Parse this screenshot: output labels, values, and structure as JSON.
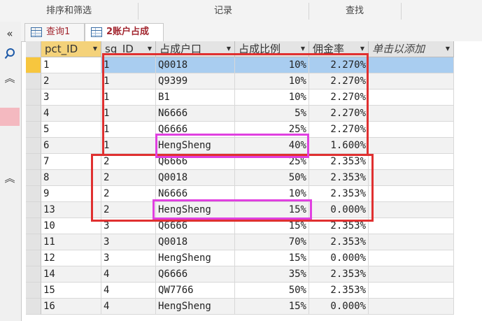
{
  "ribbon": {
    "groups": [
      "排序和筛选",
      "记录",
      "查找"
    ]
  },
  "tabs": [
    {
      "label": "查询1",
      "active": false
    },
    {
      "label": "2账户占成",
      "active": true
    }
  ],
  "columns": [
    "pct_ID",
    "sg_ID",
    "占成户口",
    "占成比例",
    "佣金率",
    "单击以添加"
  ],
  "rows": [
    {
      "pct_ID": "1",
      "sg_ID": "1",
      "account": "Q0018",
      "ratio": "10%",
      "rate": "2.270%"
    },
    {
      "pct_ID": "2",
      "sg_ID": "1",
      "account": "Q9399",
      "ratio": "10%",
      "rate": "2.270%"
    },
    {
      "pct_ID": "3",
      "sg_ID": "1",
      "account": "B1",
      "ratio": "10%",
      "rate": "2.270%"
    },
    {
      "pct_ID": "4",
      "sg_ID": "1",
      "account": "N6666",
      "ratio": "5%",
      "rate": "2.270%"
    },
    {
      "pct_ID": "5",
      "sg_ID": "1",
      "account": "Q6666",
      "ratio": "25%",
      "rate": "2.270%"
    },
    {
      "pct_ID": "6",
      "sg_ID": "1",
      "account": "HengSheng",
      "ratio": "40%",
      "rate": "1.600%"
    },
    {
      "pct_ID": "7",
      "sg_ID": "2",
      "account": "Q6666",
      "ratio": "25%",
      "rate": "2.353%"
    },
    {
      "pct_ID": "8",
      "sg_ID": "2",
      "account": "Q0018",
      "ratio": "50%",
      "rate": "2.353%"
    },
    {
      "pct_ID": "9",
      "sg_ID": "2",
      "account": "N6666",
      "ratio": "10%",
      "rate": "2.353%"
    },
    {
      "pct_ID": "13",
      "sg_ID": "2",
      "account": "HengSheng",
      "ratio": "15%",
      "rate": "0.000%"
    },
    {
      "pct_ID": "10",
      "sg_ID": "3",
      "account": "Q6666",
      "ratio": "15%",
      "rate": "2.353%"
    },
    {
      "pct_ID": "11",
      "sg_ID": "3",
      "account": "Q0018",
      "ratio": "70%",
      "rate": "2.353%"
    },
    {
      "pct_ID": "12",
      "sg_ID": "3",
      "account": "HengSheng",
      "ratio": "15%",
      "rate": "0.000%"
    },
    {
      "pct_ID": "14",
      "sg_ID": "4",
      "account": "Q6666",
      "ratio": "35%",
      "rate": "2.353%"
    },
    {
      "pct_ID": "15",
      "sg_ID": "4",
      "account": "QW7766",
      "ratio": "50%",
      "rate": "2.353%"
    },
    {
      "pct_ID": "16",
      "sg_ID": "4",
      "account": "HengSheng",
      "ratio": "15%",
      "rate": "0.000%"
    }
  ],
  "icons": {
    "nav_collapse": "double-chevron-left-icon",
    "search": "search-icon",
    "expand": "double-chevron-up-icon",
    "sort_filter": "filter-dropdown-icon",
    "table": "table-icon"
  },
  "colors": {
    "red_box": "#e03030",
    "magenta_box": "#e040e0",
    "current_row": "#a9cdf0",
    "current_selector": "#f7c63e",
    "tab_text": "#a2262f"
  }
}
